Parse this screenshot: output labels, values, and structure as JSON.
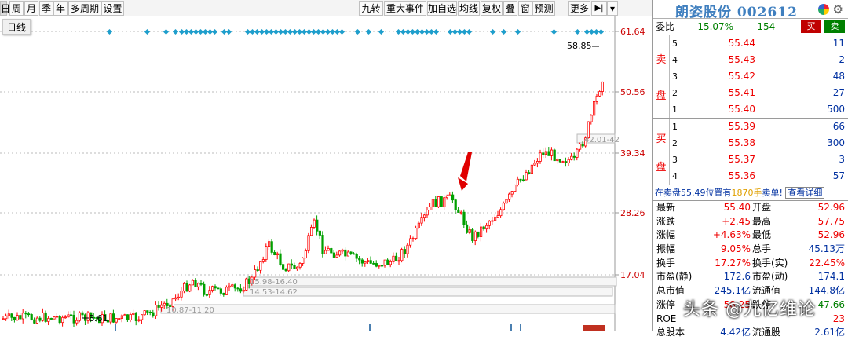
{
  "toolbar": {
    "left_buttons": [
      "日",
      "周",
      "月",
      "季",
      "年",
      "多周期",
      "设置"
    ],
    "right_buttons": [
      "九转",
      "重大事件",
      "加自选",
      "均线",
      "复权",
      "叠",
      "窗",
      "预测",
      "更多"
    ],
    "play_icon": "play-end-icon",
    "dropdown_icon": "chevron-down-icon"
  },
  "chart": {
    "period_label": "日线",
    "y_labels": [
      "61.64",
      "50.56",
      "39.34",
      "28.26",
      "17.04"
    ],
    "annotations": {
      "high": "58.85",
      "low": "8.61",
      "box1": "15.98-16.40",
      "box2": "14.53-14.62",
      "box3": "10.87-11.20",
      "box4": "42.01-42"
    },
    "colors": {
      "up": "#ff0000",
      "down": "#00a000",
      "marker": "#1e9ecc",
      "arrow": "#e00000"
    }
  },
  "stock": {
    "name": "朗姿股份",
    "code": "002612",
    "icons": [
      "colorful-ball-icon",
      "gear-icon"
    ]
  },
  "weibi": {
    "label": "委比",
    "pct": "-15.07%",
    "diff": "-154",
    "buy_btn": "买",
    "sell_btn": "卖"
  },
  "sell_side": {
    "label_top": "卖",
    "label_bottom": "盘",
    "levels": [
      {
        "n": "5",
        "price": "55.44",
        "vol": "11"
      },
      {
        "n": "4",
        "price": "55.43",
        "vol": "2"
      },
      {
        "n": "3",
        "price": "55.42",
        "vol": "48"
      },
      {
        "n": "2",
        "price": "55.41",
        "vol": "27"
      },
      {
        "n": "1",
        "price": "55.40",
        "vol": "500"
      }
    ]
  },
  "buy_side": {
    "label_top": "买",
    "label_bottom": "盘",
    "levels": [
      {
        "n": "1",
        "price": "55.39",
        "vol": "66"
      },
      {
        "n": "2",
        "price": "55.38",
        "vol": "300"
      },
      {
        "n": "3",
        "price": "55.37",
        "vol": "3"
      },
      {
        "n": "4",
        "price": "55.36",
        "vol": "57"
      }
    ]
  },
  "inner": {
    "text1": "在卖盘55.49位置有",
    "text2": "1870手",
    "text3": "卖单!",
    "link": "查看详细"
  },
  "quote": [
    [
      "最新",
      "55.40",
      "开盘",
      "52.96"
    ],
    [
      "涨跌",
      "+2.45",
      "最高",
      "57.75"
    ],
    [
      "涨幅",
      "+4.63%",
      "最低",
      "52.96"
    ],
    [
      "振幅",
      "9.05%",
      "总手",
      "45.13万"
    ],
    [
      "换手",
      "17.27%",
      "换手(实)",
      "22.45%"
    ],
    [
      "市盈(静)",
      "172.6",
      "市盈(动)",
      "174.1"
    ],
    [
      "总市值",
      "245.1亿",
      "流通值",
      "144.8亿"
    ],
    [
      "涨停",
      "58.25",
      "跌停",
      "47.66"
    ],
    [
      "ROE",
      "",
      "",
      "23"
    ],
    [
      "总股本",
      "4.42亿",
      "流通股",
      "2.61亿"
    ]
  ],
  "watermark": "头条 @九亿维论"
}
